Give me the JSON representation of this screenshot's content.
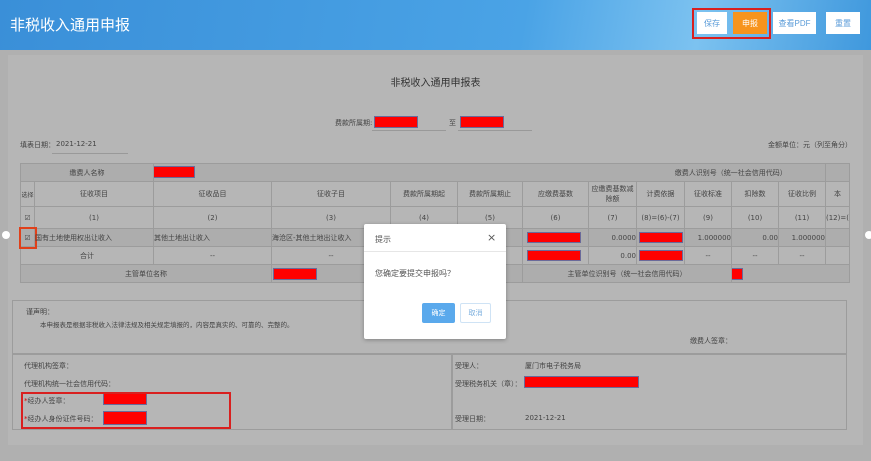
{
  "header": {
    "title": "非税收入通用申报",
    "buttons": {
      "save": "保存",
      "declare": "申报",
      "view_pdf": "查看PDF",
      "reset": "重置"
    }
  },
  "form": {
    "title": "非税收入通用申报表",
    "period_label": "费款所属期:",
    "period_to": "至",
    "fill_date_label": "填表日期：",
    "fill_date": "2021-12-21",
    "unit": "金额单位：元（列至角分）",
    "payer_name_label": "缴费人名称",
    "payer_id_label": "缴费人识别号（统一社会信用代码）",
    "columns": [
      "选择",
      "征收项目",
      "征收品目",
      "征收子目",
      "费款所属期起",
      "费款所属期止",
      "应缴费基数",
      "应缴费基数减除额",
      "计费依据",
      "征收标准",
      "扣除数",
      "征收比例",
      "本"
    ],
    "col_numbers": [
      "(1)",
      "(2)",
      "(3)",
      "(4)",
      "(5)",
      "(6)",
      "(7)",
      "(8)=(6)-(7)",
      "(9)",
      "(10)",
      "(11)",
      "(12)=("
    ],
    "row": {
      "item": "国有土地使用权出让收入",
      "category": "其他土地出让收入",
      "subitem": "海沧区-其他土地出让收入",
      "deduction": "0.0000",
      "standard": "1.000000",
      "deduct": "0.00",
      "ratio": "1.000000"
    },
    "total": {
      "label": "合计",
      "c2": "--",
      "c3": "--",
      "deduction": "0.00",
      "c9": "--",
      "c10": "--",
      "c11": "--"
    },
    "supervisor_name_label": "主管单位名称",
    "supervisor_id_label": "主管单位识别号（统一社会信用代码）",
    "declaration_title": "谨声明：",
    "declaration_text": "本申报表是根据非税收入法律法规及相关规定填报的，内容是真实的、可靠的、完整的。",
    "payer_seal": "缴费人签章：",
    "agent_seal": "代理机构签章：",
    "agent_code": "代理机构统一社会信用代码：",
    "handler_seal": "经办人签章：",
    "handler_id": "经办人身份证件号码：",
    "receiver_label": "受理人：",
    "receiver": "厦门市电子税务局",
    "tax_office_label": "受理税务机关（章）：",
    "receive_date_label": "受理日期：",
    "receive_date": "2021-12-21"
  },
  "dialog": {
    "title": "提示",
    "message": "您确定要提交申报吗？",
    "confirm": "确定",
    "cancel": "取消",
    "close": "×"
  }
}
